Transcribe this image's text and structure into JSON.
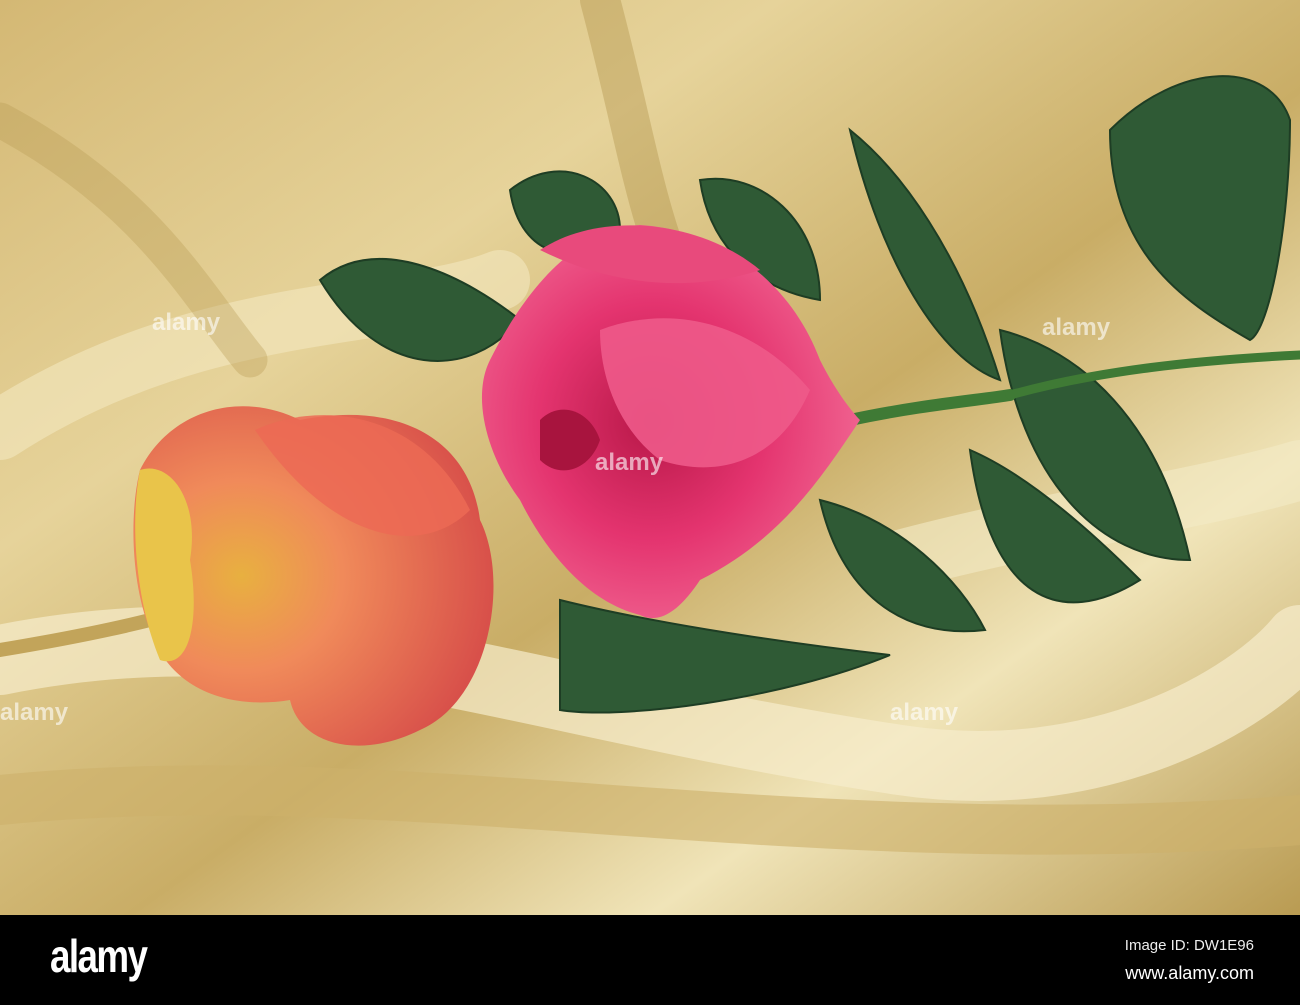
{
  "photo": {
    "subject": "Two roses on gold satin",
    "colors": {
      "satin_light": "#efe2b0",
      "satin_mid": "#d9c27d",
      "satin_dark": "#a8893f",
      "pink_rose": "#e0306a",
      "orange_rose": "#e8704a",
      "yellow_petal": "#e9c44a",
      "leaf": "#2f5a35"
    }
  },
  "watermark": {
    "text": "alamy"
  },
  "footer": {
    "logo": "alamy",
    "image_id": "Image ID: DW1E96",
    "url": "www.alamy.com"
  }
}
